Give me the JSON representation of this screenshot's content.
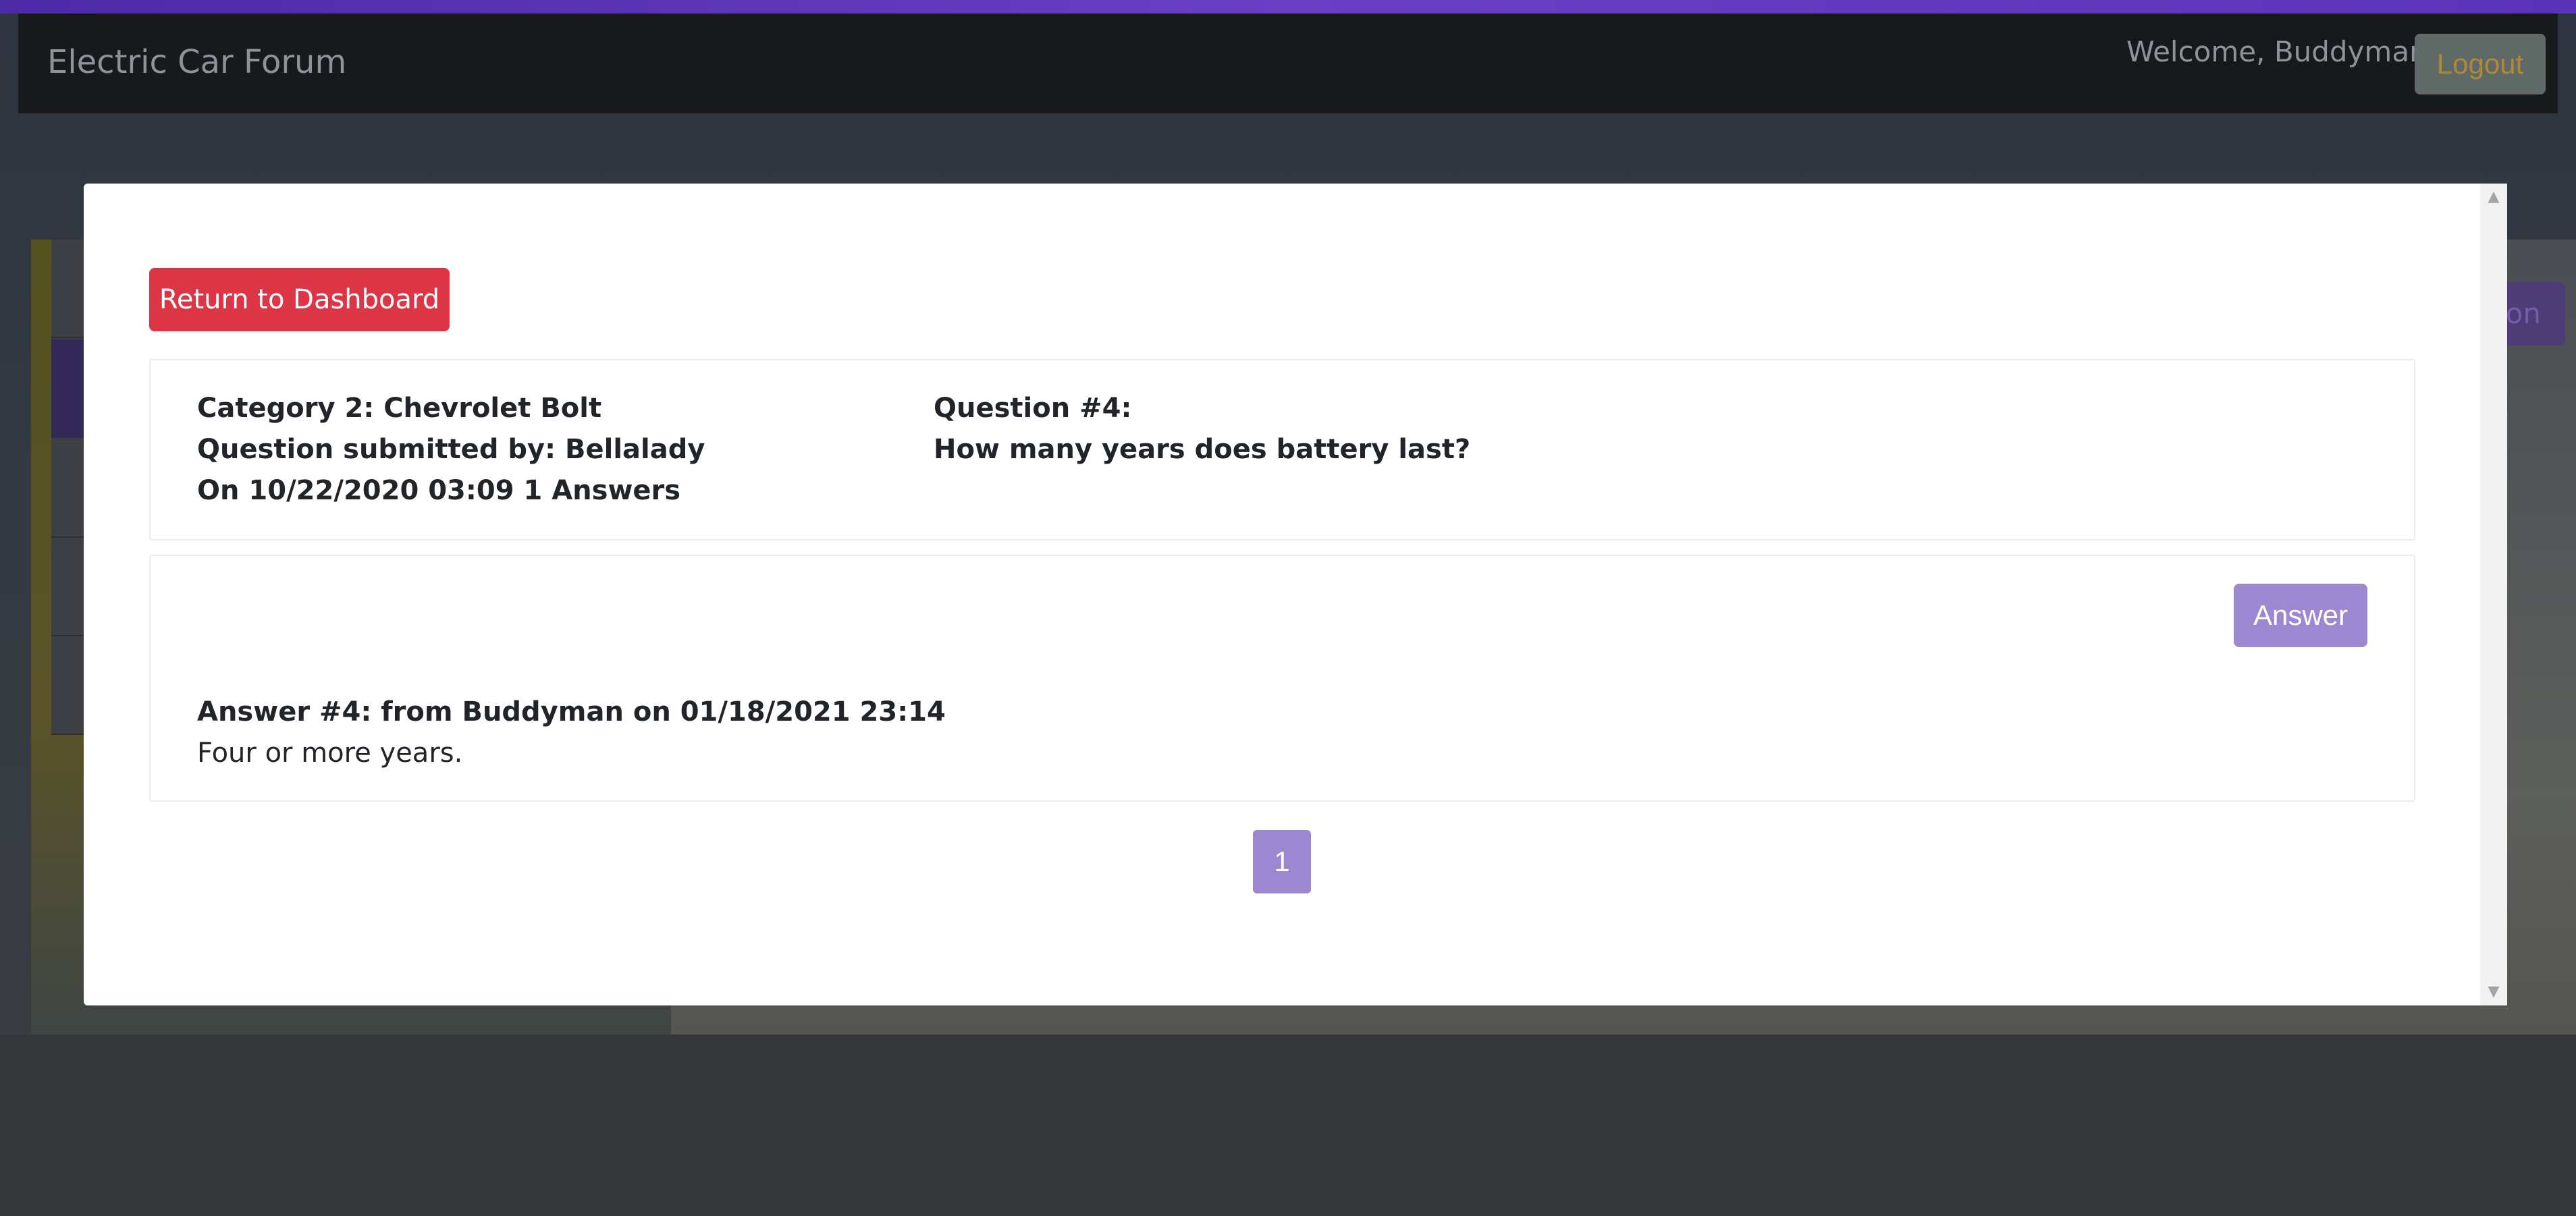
{
  "app": {
    "brand": "Electric Car Forum",
    "welcome": "Welcome, Buddyman",
    "logout_label": "Logout"
  },
  "background": {
    "action_label": "ion"
  },
  "modal": {
    "return_label": "Return to Dashboard",
    "question": {
      "category": "Category 2: Chevrolet Bolt",
      "submitted_by": "Question submitted by: Bellalady",
      "meta": "On 10/22/2020 03:09 1 Answers",
      "number": "Question #4:",
      "text": "How many years does battery last?"
    },
    "answer_button_label": "Answer",
    "answers": [
      {
        "header": "Answer #4: from Buddyman on 01/18/2021 23:14",
        "body": "Four or more years."
      }
    ],
    "pagination": [
      "1"
    ]
  },
  "colors": {
    "danger": "#dc3545",
    "accent": "#9b88d0",
    "navbar": "#17191d",
    "brand_strip": "#5a34b8"
  }
}
